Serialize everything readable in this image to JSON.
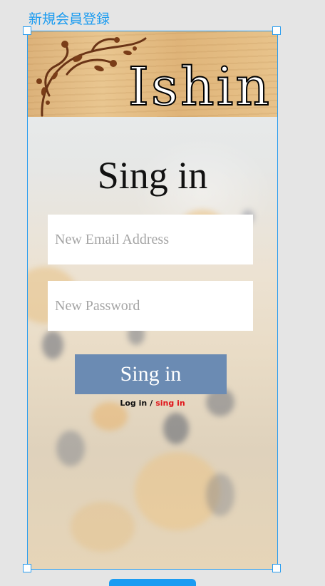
{
  "canvas": {
    "frame_label": "新規会員登録"
  },
  "screen": {
    "brand": "Ishin",
    "title": "Sing in",
    "email_placeholder": "New Email Address",
    "password_placeholder": "New Password",
    "submit_label": "Sing in",
    "login_link": "Log in",
    "separator": "/",
    "signin_link": "sing in"
  },
  "colors": {
    "selection": "#2a9df0",
    "button": "#6b8bb3",
    "signin_link": "#e0151b"
  }
}
